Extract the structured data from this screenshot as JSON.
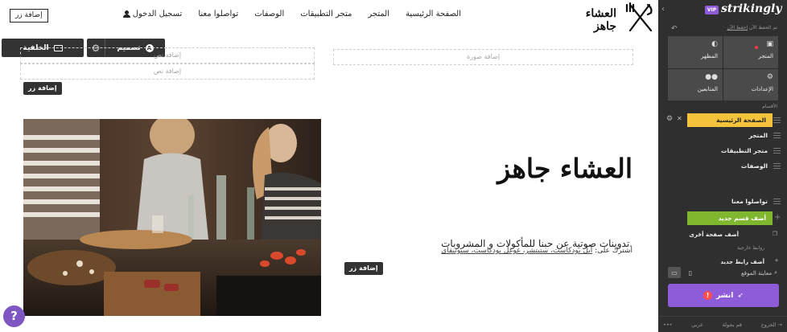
{
  "site": {
    "brand": "العشاء جاهز",
    "nav": [
      "الصفحة الرئيسية",
      "المتجر",
      "متجر التطبيقات",
      "الوصفات",
      "تواصلوا معنا",
      "تسجيل الدخول"
    ],
    "nav_button": "إضافة زر"
  },
  "toolbar": {
    "design_label": "تصميم",
    "design_badge": "A",
    "background_label": "الخلفية"
  },
  "placeholders": {
    "add_image": "إضافة صورة",
    "add_text_1": "إضافة نص",
    "add_text_2": "إضافة نص",
    "add_button": "إضافة زر",
    "add_button_hero": "إضافة زر"
  },
  "hero": {
    "title": "العشاء جاهز",
    "subtitle": "تدوينات صوتية عن حبنا للمأكولات و المشروبات.",
    "subscribe_prefix": "اشترك على:",
    "subscribe_links": "أبل بودكاست، ستيتشر، غوغل بودكاست، سبوتيفاي"
  },
  "help": {
    "label": "?"
  },
  "sidebar": {
    "logo": "strikingly",
    "vip": "VIP",
    "saved_text": "تم الحفظ الآن",
    "saved_link": "إحفظ الآن",
    "tiles": [
      {
        "label": "المظهر",
        "icon": "palette-icon"
      },
      {
        "label": "المتجر",
        "icon": "store-icon"
      },
      {
        "label": "المتابعين",
        "icon": "followers-icon"
      },
      {
        "label": "الإعدادات",
        "icon": "settings-icon"
      }
    ],
    "sections_label": "الأقسام",
    "sections": [
      "الصفحة الرئيسية",
      "المتجر",
      "متجر التطبيقات",
      "الوصفات",
      "تواصلوا معنا"
    ],
    "add_section": "أضف قسم جديد",
    "add_page": "أضف صفحة أخرى",
    "external_links_label": "روابط خارجية",
    "add_link": "أضف رابط جديد",
    "preview_label": "معاينة الموقع",
    "publish_label": "انشر",
    "publish_warning": "!",
    "footer": {
      "logout": "الخروج",
      "tour": "قم بجولة",
      "lang": "عربي",
      "more": "•••"
    }
  },
  "colors": {
    "sidebar_bg": "#2f2f2f",
    "tile_bg": "#4a4a4a",
    "active_section": "#f5c33b",
    "add_section": "#7fb72e",
    "publish": "#8e5cd9",
    "help": "#7e57c2"
  }
}
